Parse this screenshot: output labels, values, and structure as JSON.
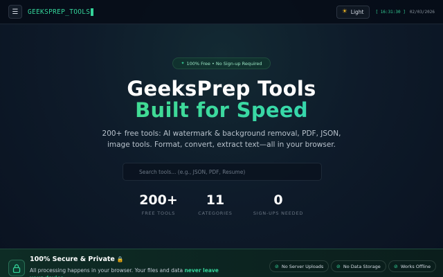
{
  "header": {
    "menu_icon": "☰",
    "logo": "GEEKSPREP_TOOLS",
    "theme_button": {
      "icon": "☀",
      "label": "Light"
    },
    "clock": {
      "time": "16:31:30",
      "date": "02/03/2026"
    }
  },
  "hero": {
    "badge": "100% Free • No Sign-up Required",
    "title_line1": "GeeksPrep Tools",
    "title_line2": "Built for Speed",
    "subtitle": "200+ free tools: AI watermark & background removal, PDF, JSON, image tools. Format, convert, extract text—all in your browser.",
    "search": {
      "placeholder": "Search tools... (e.g., JSON, PDF, Resume)",
      "value": ""
    }
  },
  "stats": [
    {
      "value": "200+",
      "label": "FREE TOOLS"
    },
    {
      "value": "11",
      "label": "CATEGORIES"
    },
    {
      "value": "0",
      "label": "SIGN-UPS NEEDED"
    }
  ],
  "privacy": {
    "title": "100% Secure & Private",
    "title_icon": "🔒",
    "text_before": "All processing happens in your browser. Your files and data ",
    "text_strong": "never leave your device",
    "text_after": ".",
    "pills": [
      "No Server Uploads",
      "No Data Storage",
      "Works Offline"
    ]
  },
  "colors": {
    "accent": "#34d399",
    "background": "#0e1b2a",
    "header": "#060c16"
  }
}
